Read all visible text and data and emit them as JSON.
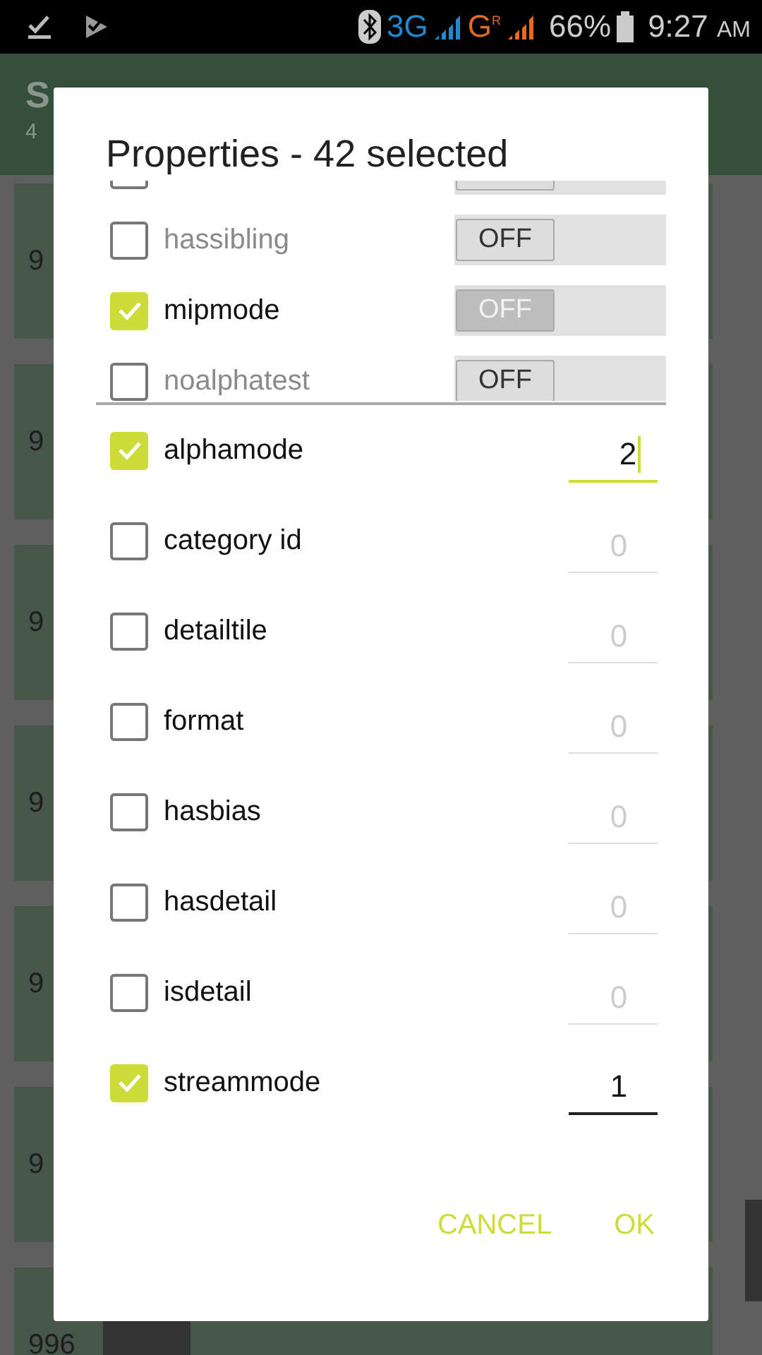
{
  "status_bar": {
    "network_1": "3G",
    "network_2": "G",
    "roaming": "R",
    "battery": "66%",
    "time": "9:27",
    "ampm": "AM"
  },
  "app_bar": {
    "title": "S",
    "subtitle": "4"
  },
  "background_cards": [
    {
      "number": "9"
    },
    {
      "number": "9"
    },
    {
      "number": "9"
    },
    {
      "number": "9"
    },
    {
      "number": "9"
    },
    {
      "number": "9"
    },
    {
      "number": "996"
    }
  ],
  "dialog": {
    "title": "Properties - 42 selected",
    "switch_rows": [
      {
        "kind": "partial",
        "checked": false,
        "disabled": false
      },
      {
        "kind": "full",
        "label": "hassibling",
        "checked": false,
        "switch": "OFF",
        "disabled": false
      },
      {
        "kind": "full",
        "label": "mipmode",
        "checked": true,
        "switch": "OFF",
        "disabled": true
      },
      {
        "kind": "full",
        "label": "noalphatest",
        "checked": false,
        "switch": "OFF",
        "disabled": false
      }
    ],
    "field_rows": [
      {
        "label": "alphamode",
        "checked": true,
        "value": "2",
        "focused": true
      },
      {
        "label": "category id",
        "checked": false,
        "value": "0",
        "focused": false
      },
      {
        "label": "detailtile",
        "checked": false,
        "value": "0",
        "focused": false
      },
      {
        "label": "format",
        "checked": false,
        "value": "0",
        "focused": false
      },
      {
        "label": "hasbias",
        "checked": false,
        "value": "0",
        "focused": false
      },
      {
        "label": "hasdetail",
        "checked": false,
        "value": "0",
        "focused": false
      },
      {
        "label": "isdetail",
        "checked": false,
        "value": "0",
        "focused": false
      },
      {
        "label": "streammode",
        "checked": true,
        "value": "1",
        "focused": false
      }
    ],
    "buttons": [
      "CANCEL",
      "OK"
    ]
  }
}
